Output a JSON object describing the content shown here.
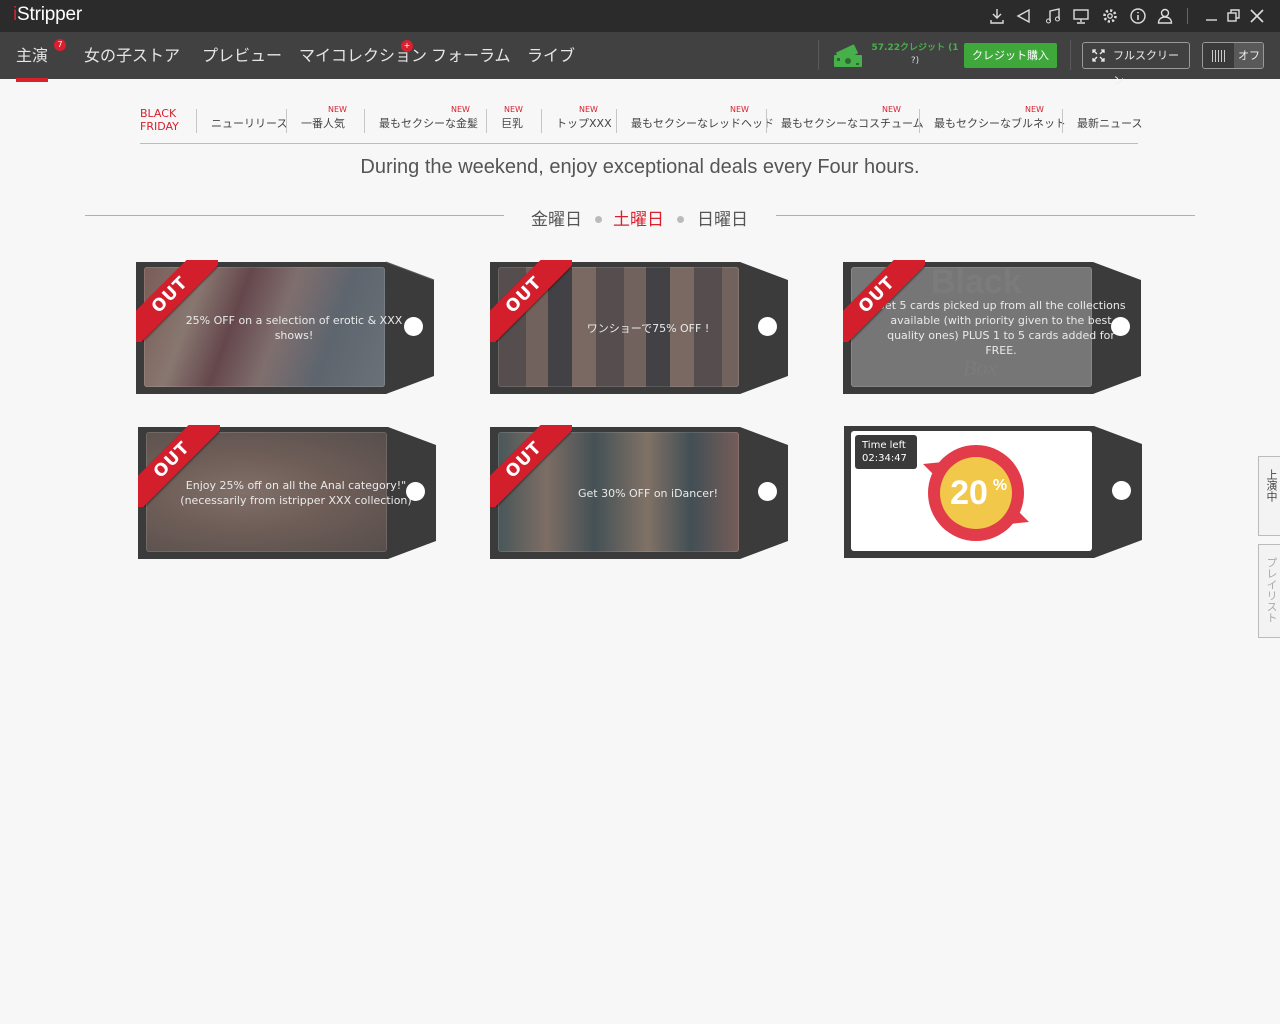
{
  "app": {
    "logo_i": "i",
    "logo_rest": "Stripper"
  },
  "titlebar": {
    "icons": [
      "download-icon",
      "announcement-icon",
      "music-icon",
      "monitor-icon",
      "gear-icon",
      "info-icon",
      "user-icon",
      "minimize-icon",
      "restore-icon",
      "close-icon"
    ]
  },
  "nav": {
    "tabs": [
      {
        "label": "主演",
        "badge": "7",
        "active": true
      },
      {
        "label": "女の子ストア"
      },
      {
        "label": "プレビュー"
      },
      {
        "label": "マイコレクション",
        "badge": "+"
      },
      {
        "label": "フォーラム"
      },
      {
        "label": "ライブ"
      }
    ],
    "credits": "57.22クレジット (1",
    "credits_suffix": "?)",
    "buy_label": "クレジット購入",
    "fullscreen_label": "フルスクリーン",
    "toggle_label": "オフ",
    "accent": "#d8202f",
    "buy_color": "#3ea93a"
  },
  "categories": [
    {
      "label": "BLACK",
      "label2": "FRIDAY",
      "active": true
    },
    {
      "label": "ニューリリース"
    },
    {
      "label": "一番人気",
      "new": "NEW"
    },
    {
      "label": "最もセクシーな金髪",
      "new": "NEW"
    },
    {
      "label": "巨乳",
      "new": "NEW"
    },
    {
      "label": "トップXXX",
      "new": "NEW"
    },
    {
      "label": "最もセクシーなレッドヘッド",
      "new": "NEW"
    },
    {
      "label": "最もセクシーなコスチューム",
      "new": "NEW"
    },
    {
      "label": "最もセクシーなブルネット",
      "new": "NEW"
    },
    {
      "label": "最新ニュース"
    }
  ],
  "headline": "During the weekend, enjoy exceptional deals every Four hours.",
  "days": [
    {
      "label": "金曜日"
    },
    {
      "label": "土曜日",
      "active": true
    },
    {
      "label": "日曜日"
    }
  ],
  "deals": [
    {
      "ribbon": "OUT",
      "text": "25% OFF on a selection of erotic & XXX shows!"
    },
    {
      "ribbon": "OUT",
      "text": "ワンショーで75% OFF !"
    },
    {
      "ribbon": "OUT",
      "text": "Get 5 cards picked up from all the collections available (with priority given to the best quality ones) PLUS 1 to 5 cards added for FREE.",
      "watermark": "Black",
      "watermark2": "Box"
    },
    {
      "ribbon": "OUT",
      "text": "Enjoy 25% off on all the Anal category!\" (necessarily from istripper XXX collection)"
    },
    {
      "ribbon": "OUT",
      "text": "Get 30% OFF on iDancer!"
    },
    {
      "timer_label": "Time left",
      "timer_value": "02:34:47",
      "percent": "20",
      "percent_sign": "%"
    }
  ],
  "side_tabs": [
    {
      "label": "上演中"
    },
    {
      "label": "プレイリスト"
    }
  ]
}
